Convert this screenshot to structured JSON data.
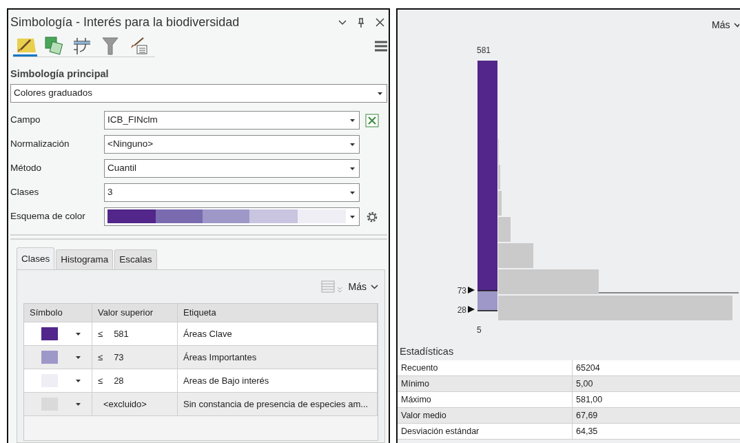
{
  "window": {
    "title": "Simbología - Interés para la biodiversidad"
  },
  "tool_tabs": [
    {
      "kind": "primary",
      "selected": true
    },
    {
      "kind": "vary",
      "selected": false
    },
    {
      "kind": "labels",
      "selected": false
    },
    {
      "kind": "filter",
      "selected": false
    },
    {
      "kind": "display",
      "selected": false
    }
  ],
  "section_title": "Simbología principal",
  "renderer": {
    "value": "Colores graduados"
  },
  "fields": [
    {
      "kind": "field",
      "label": "Campo",
      "value": "ICB_FINclm"
    },
    {
      "kind": "dropdown",
      "label": "Normalización",
      "value": "<Ninguno>"
    },
    {
      "kind": "dropdown",
      "label": "Método",
      "value": "Cuantil"
    },
    {
      "kind": "dropdown",
      "label": "Clases",
      "value": "3"
    },
    {
      "kind": "ramp",
      "label": "Esquema de color"
    }
  ],
  "tabs": [
    {
      "label": "Clases",
      "selected": true
    },
    {
      "label": "Histograma",
      "selected": false
    },
    {
      "label": "Escalas",
      "selected": false
    }
  ],
  "more_button": "Más",
  "classes_table": {
    "columns": [
      "Símbolo",
      "Valor superior",
      "Etiqueta"
    ],
    "rows": [
      {
        "color": "#52268a",
        "operator": "≤",
        "value": "581",
        "label": "Áreas Clave"
      },
      {
        "color": "#9e98c8",
        "operator": "≤",
        "value": "73",
        "label": "Áreas Importantes"
      },
      {
        "color": "#efeef5",
        "operator": "≤",
        "value": "28",
        "label": "Areas de Bajo interés"
      },
      {
        "color": "#dadada",
        "value": "<excluido>",
        "label": "Sin constancia de presencia de especies am..."
      }
    ]
  },
  "histogram": {
    "more_button": "Más",
    "max_label": "581",
    "break_labels": [
      "73",
      "28"
    ],
    "min_label": "5"
  },
  "statistics": {
    "title": "Estadísticas",
    "rows": [
      {
        "name": "Recuento",
        "value": "65204"
      },
      {
        "name": "Mínimo",
        "value": "5,00"
      },
      {
        "name": "Máximo",
        "value": "581,00"
      },
      {
        "name": "Valor medio",
        "value": "67,69"
      },
      {
        "name": "Desviación estándar",
        "value": "64,35"
      }
    ]
  }
}
